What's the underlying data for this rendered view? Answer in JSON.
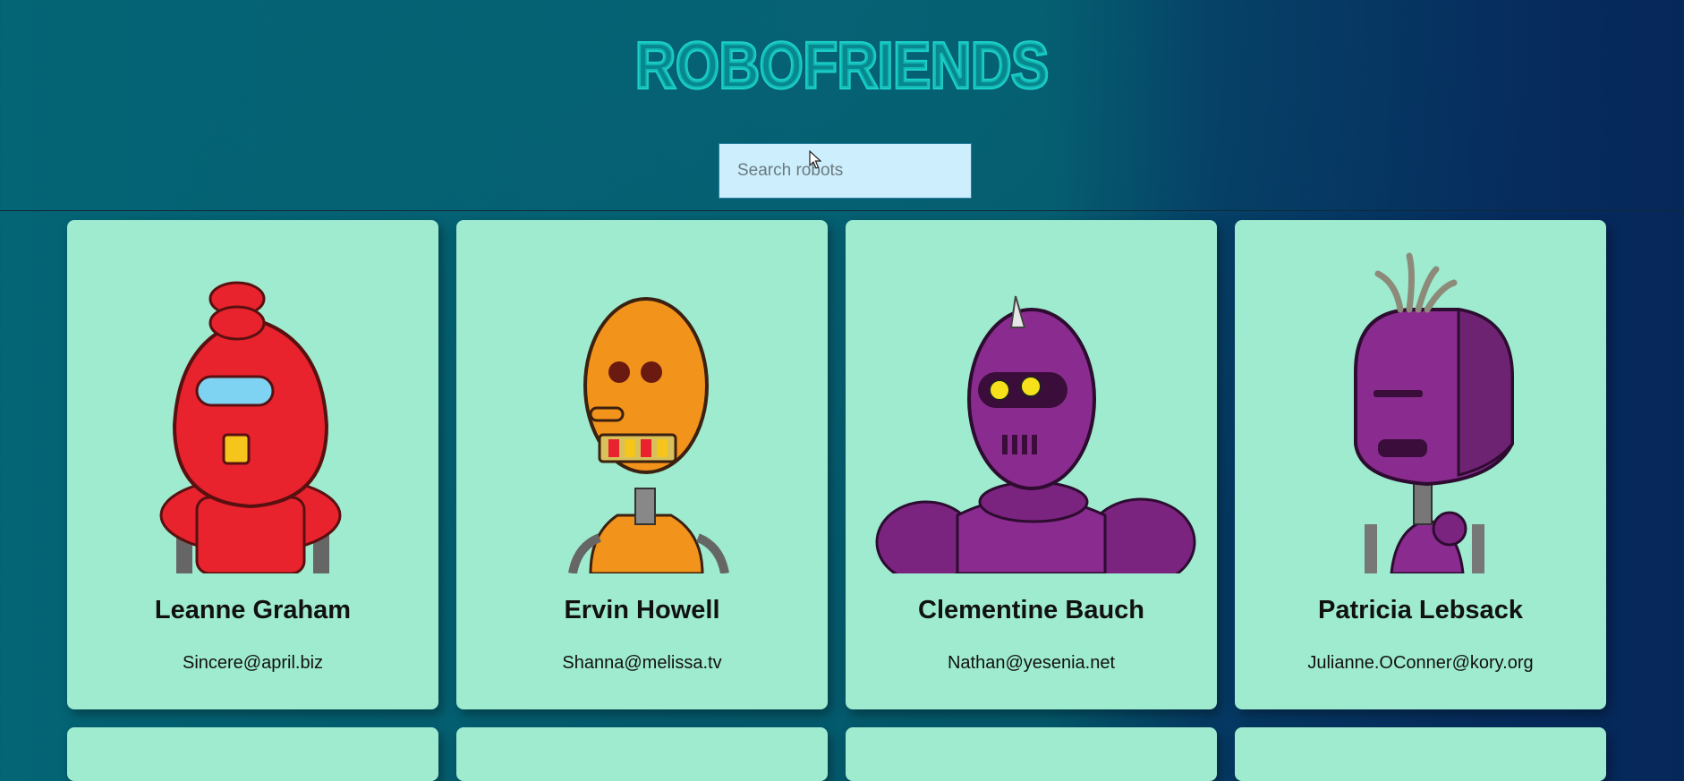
{
  "app": {
    "logo_text": "ROBOFRIENDS"
  },
  "search": {
    "placeholder": "Search robots",
    "value": ""
  },
  "robots": [
    {
      "name": "Leanne Graham",
      "email": "Sincere@april.biz",
      "color": "#e8232e",
      "icon": "robot-avatar"
    },
    {
      "name": "Ervin Howell",
      "email": "Shanna@melissa.tv",
      "color": "#f2931c",
      "icon": "robot-avatar"
    },
    {
      "name": "Clementine Bauch",
      "email": "Nathan@yesenia.net",
      "color": "#8a2c8f",
      "icon": "robot-avatar"
    },
    {
      "name": "Patricia Lebsack",
      "email": "Julianne.OConner@kory.org",
      "color": "#8a2c8f",
      "icon": "robot-avatar"
    }
  ],
  "colors": {
    "card_bg": "#9eebcf",
    "logo": "#1ccfc9",
    "search_bg": "#cdeefc"
  }
}
